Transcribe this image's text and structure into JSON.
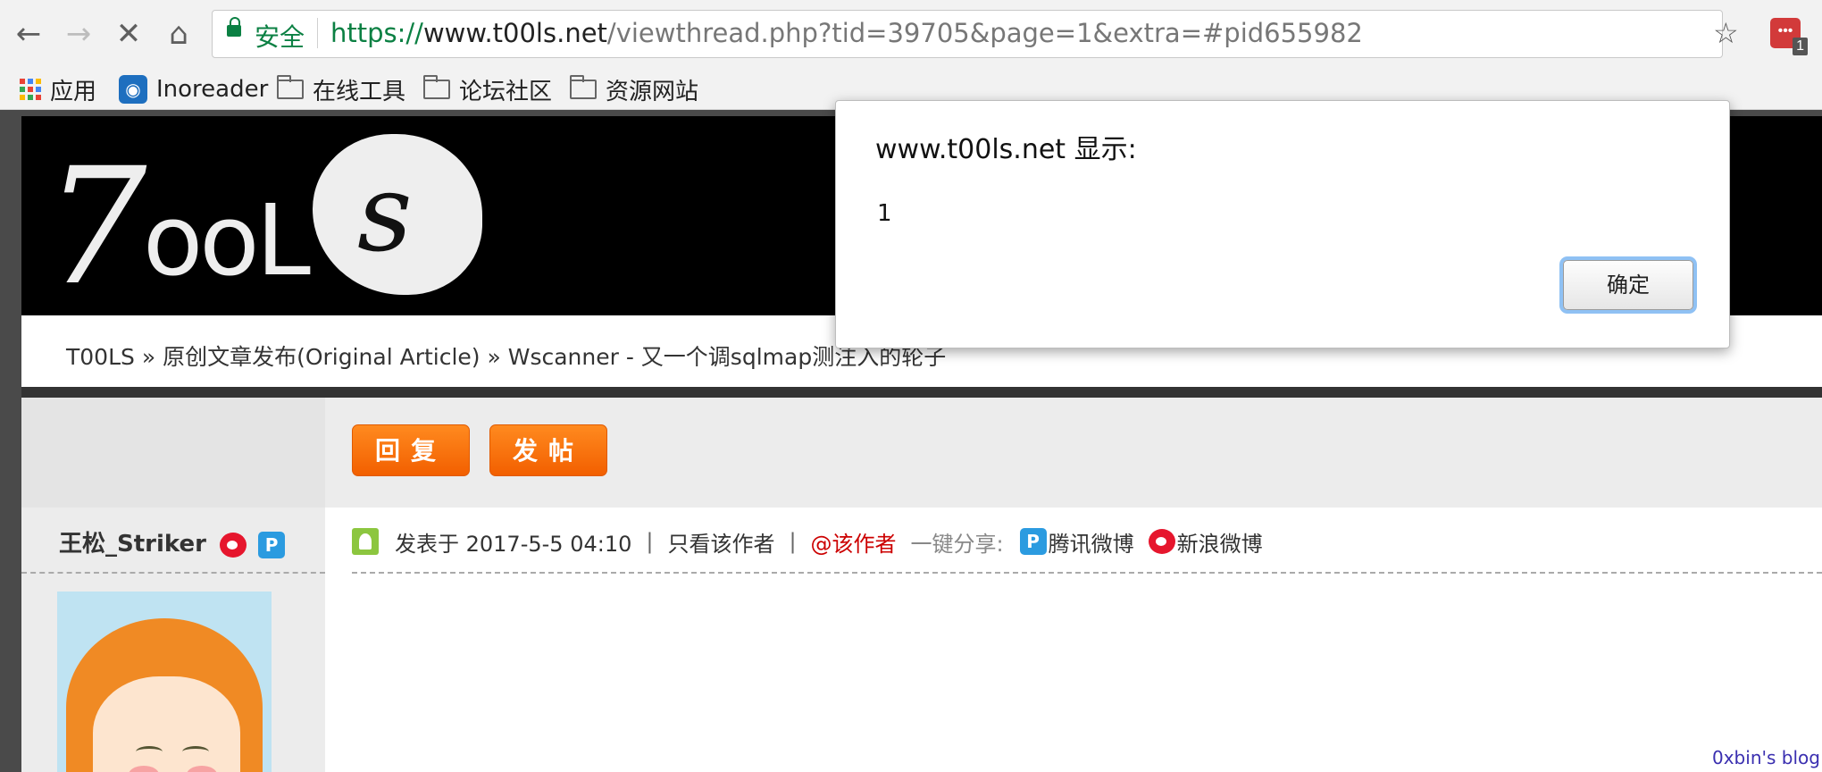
{
  "browser": {
    "security_label": "安全",
    "url_scheme": "https://",
    "url_host": "www.t00ls.net",
    "url_path": "/viewthread.php?tid=39705&page=1&extra=#pid655982",
    "extension_badge": "1"
  },
  "bookmarks": {
    "apps": "应用",
    "inoreader": "Inoreader",
    "folder1": "在线工具",
    "folder2": "论坛社区",
    "folder3": "资源网站"
  },
  "breadcrumb": {
    "text": "T00LS » 原创文章发布(Original Article) » Wscanner - 又一个调sqlmap测注入的轮子"
  },
  "actions": {
    "reply": "回复",
    "new_post": "发帖"
  },
  "post": {
    "author": "王松_Striker",
    "posted_at": "发表于 2017-5-5 04:10",
    "only_author": "只看该作者",
    "at_author": "@该作者",
    "share_label": "一键分享:",
    "share_tencent": "腾讯微博",
    "share_sina": "新浪微博"
  },
  "dialog": {
    "title": "www.t00ls.net 显示:",
    "message": "1",
    "ok": "确定"
  },
  "watermark": "0xbin's blog"
}
